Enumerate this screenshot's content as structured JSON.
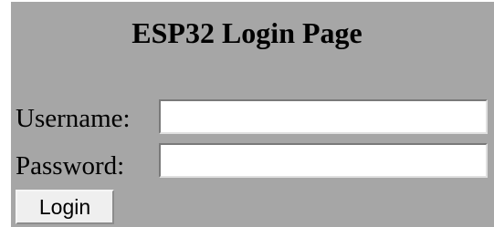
{
  "page": {
    "title": "ESP32 Login Page"
  },
  "form": {
    "username_label": "Username:",
    "password_label": "Password:",
    "username_value": "",
    "password_value": "",
    "login_label": "Login"
  },
  "colors": {
    "panel_background": "#a6a6a6",
    "input_background": "#ffffff",
    "button_background": "#efefef"
  }
}
